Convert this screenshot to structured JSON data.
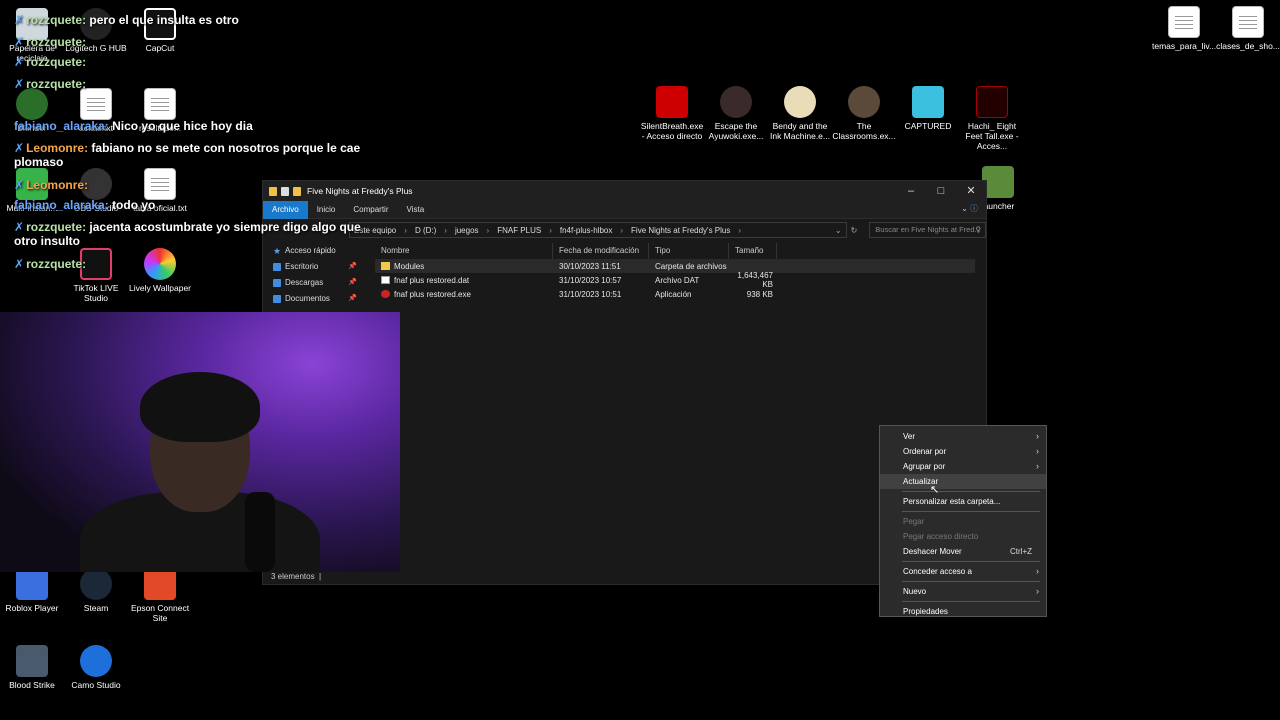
{
  "desktop": {
    "icons": [
      {
        "label": "Papelera de reciclaje"
      },
      {
        "label": "Logitech G HUB"
      },
      {
        "label": "CapCut"
      },
      {
        "label": "Blender"
      },
      {
        "label": "actual.txt"
      },
      {
        "label": "resultado..."
      },
      {
        "label": "Multi-Instan..."
      },
      {
        "label": "OBS Studio"
      },
      {
        "label": "tabla oficial.txt"
      },
      {
        "label": "TikTok LIVE Studio"
      },
      {
        "label": "Lively Wallpaper"
      },
      {
        "label": "Roblox Player"
      },
      {
        "label": "Steam"
      },
      {
        "label": "Epson Connect Site"
      },
      {
        "label": "Blood Strike"
      },
      {
        "label": "Camo Studio"
      },
      {
        "label": "SilentBreath.exe - Acceso directo"
      },
      {
        "label": "Escape the Ayuwoki.exe..."
      },
      {
        "label": "Bendy and the Ink Machine.e..."
      },
      {
        "label": "The Classrooms.ex..."
      },
      {
        "label": "CAPTURED"
      },
      {
        "label": "Hachi_ Eight Feet Tall.exe - Acces..."
      },
      {
        "label": "temas_para_liv..."
      },
      {
        "label": "clases_de_sho..."
      },
      {
        "label": "launcher"
      }
    ]
  },
  "chat": [
    {
      "user": "rozzquete:",
      "text": "pero el que insulta es otro",
      "color": "green"
    },
    {
      "user": "rozzquete:",
      "text": "",
      "color": "green"
    },
    {
      "user": "rozzquete:",
      "text": "",
      "color": "green"
    },
    {
      "user": "rozzquete:",
      "text": "",
      "color": "green"
    },
    {
      "user": "fabiano_alaraka:",
      "text": "Nico yo que hice hoy dia",
      "color": "blue"
    },
    {
      "user": "Leomonre:",
      "text": "fabiano no se mete con nosotros porque le cae plomaso",
      "color": "orange"
    },
    {
      "user": "Leomonre:",
      "text": "",
      "color": "orange"
    },
    {
      "user": "fabiano_alaraka:",
      "text": "todo yo",
      "color": "blue"
    },
    {
      "user": "rozzquete:",
      "text": "jacenta acostumbrate yo siempre digo algo que otro insulto",
      "color": "green"
    },
    {
      "user": "rozzquete:",
      "text": "",
      "color": "green"
    }
  ],
  "explorer": {
    "title": "Five Nights at Freddy's Plus",
    "ribbon_tabs": [
      "Archivo",
      "Inicio",
      "Compartir",
      "Vista"
    ],
    "breadcrumb": [
      "Este equipo",
      "D (D:)",
      "juegos",
      "FNAF PLUS",
      "fn4f-plus-hlbox",
      "Five Nights at Freddy's Plus"
    ],
    "search_placeholder": "Buscar en Five Nights at Fred...",
    "nav_items": [
      {
        "label": "Acceso rápido",
        "pinned": false
      },
      {
        "label": "Escritorio",
        "pinned": true
      },
      {
        "label": "Descargas",
        "pinned": true
      },
      {
        "label": "Documentos",
        "pinned": true
      }
    ],
    "columns": [
      "Nombre",
      "Fecha de modificación",
      "Tipo",
      "Tamaño"
    ],
    "files": [
      {
        "name": "Modules",
        "date": "30/10/2023 11:51",
        "type": "Carpeta de archivos",
        "size": "",
        "icon": "folder-icon"
      },
      {
        "name": "fnaf plus restored.dat",
        "date": "31/10/2023 10:57",
        "type": "Archivo DAT",
        "size": "1,643,467 KB",
        "icon": "dat-file-icon"
      },
      {
        "name": "fnaf plus restored.exe",
        "date": "31/10/2023 10:51",
        "type": "Aplicación",
        "size": "938 KB",
        "icon": "exe-file-icon"
      }
    ],
    "status": "3 elementos"
  },
  "context_menu": {
    "items": [
      {
        "label": "Ver",
        "submenu": true
      },
      {
        "label": "Ordenar por",
        "submenu": true
      },
      {
        "label": "Agrupar por",
        "submenu": true
      },
      {
        "label": "Actualizar",
        "highlighted": true
      },
      {
        "label": "Personalizar esta carpeta..."
      },
      {
        "label": "Pegar",
        "disabled": true
      },
      {
        "label": "Pegar acceso directo",
        "disabled": true
      },
      {
        "label": "Deshacer Mover",
        "shortcut": "Ctrl+Z"
      },
      {
        "label": "Conceder acceso a",
        "submenu": true
      },
      {
        "label": "Nuevo",
        "submenu": true
      },
      {
        "label": "Propiedades"
      }
    ]
  }
}
